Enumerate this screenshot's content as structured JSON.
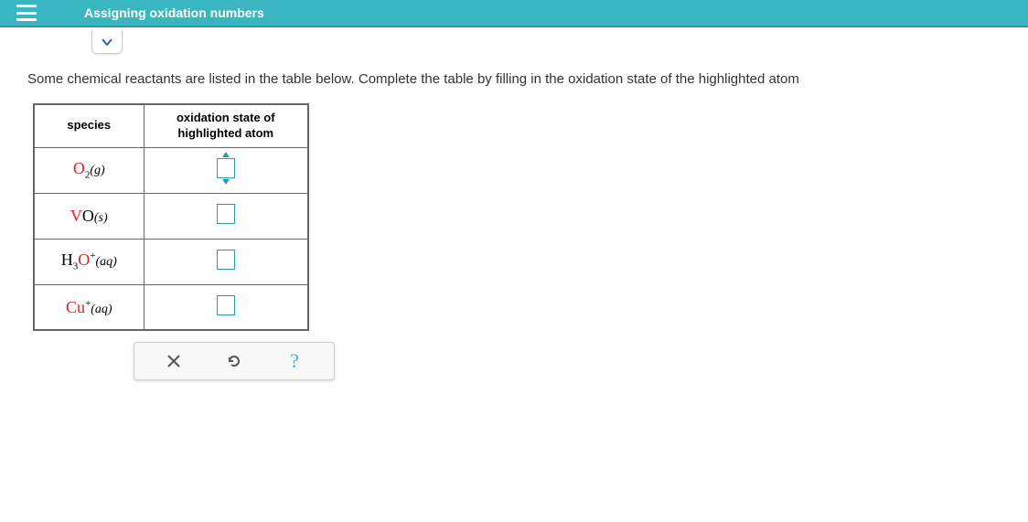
{
  "header": {
    "title": "Assigning oxidation numbers"
  },
  "instruction": "Some chemical reactants are listed in the table below. Complete the table by filling in the oxidation state of the highlighted atom",
  "table": {
    "headers": {
      "species": "species",
      "oxidation": "oxidation state of\nhighlighted atom"
    },
    "rows": [
      {
        "highlighted_element": "O",
        "subscript": "2",
        "superscript": "",
        "phase": "(g)",
        "prefix": "",
        "input_value": "",
        "active": true
      },
      {
        "highlighted_element": "V",
        "subscript": "",
        "superscript": "",
        "phase": "(s)",
        "prefix": "",
        "suffix_element": "O",
        "input_value": "",
        "active": false
      },
      {
        "highlighted_element": "O",
        "subscript": "",
        "superscript": "+",
        "phase": "(aq)",
        "prefix": "H",
        "prefix_sub": "3",
        "input_value": "",
        "active": false
      },
      {
        "highlighted_element": "Cu",
        "subscript": "",
        "superscript": "+",
        "phase": "(aq)",
        "prefix": "",
        "input_value": "",
        "active": false
      }
    ]
  },
  "toolbar": {
    "clear_label": "clear",
    "reset_label": "reset",
    "help_label": "?"
  }
}
